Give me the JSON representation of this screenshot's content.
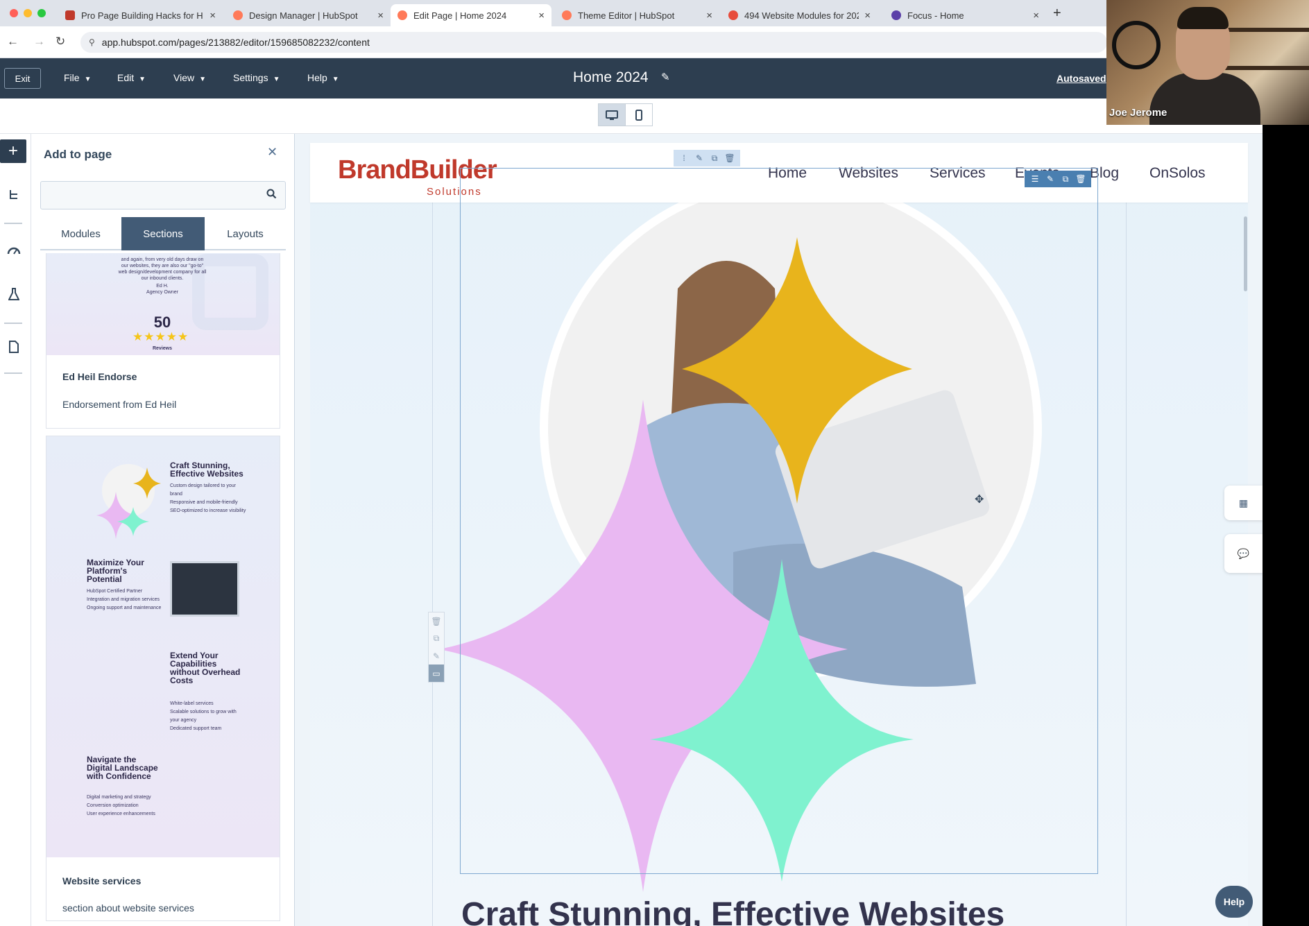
{
  "browser": {
    "tabs": [
      {
        "title": "Pro Page Building Hacks for H",
        "favicon_color": "#c0392b"
      },
      {
        "title": "Design Manager | HubSpot",
        "favicon_color": "#ff7a59"
      },
      {
        "title": "Edit Page | Home 2024",
        "favicon_color": "#ff7a59"
      },
      {
        "title": "Theme Editor | HubSpot",
        "favicon_color": "#ff7a59"
      },
      {
        "title": "494 Website Modules for 202",
        "favicon_color": "#e74c3c"
      },
      {
        "title": "Focus - Home",
        "favicon_color": "#5b3fa8"
      }
    ],
    "url": "app.hubspot.com/pages/213882/editor/159685082232/content"
  },
  "editor": {
    "exit_label": "Exit",
    "menus": [
      "File",
      "Edit",
      "View",
      "Settings",
      "Help"
    ],
    "page_title": "Home 2024",
    "autosaved_label": "Autosaved"
  },
  "panel": {
    "title": "Add to page",
    "search_placeholder": "",
    "tabs": [
      "Modules",
      "Sections",
      "Layouts"
    ],
    "active_tab": "Sections",
    "cards": [
      {
        "name": "Ed Heil Endorse",
        "description": "Endorsement from Ed Heil",
        "thumb": {
          "quote": "and again, from very old days draw on our websites, they are also our \"go-to\" web design/development company for all our inbound clients.",
          "author": "Ed H.",
          "author_role": "Agency Owner",
          "review_count": "50",
          "review_label": "Reviews",
          "stars": "★★★★★"
        }
      },
      {
        "name": "Website services",
        "description": "section about website services",
        "thumb": {
          "h1": "Craft Stunning, Effective Websites",
          "h2": "Maximize Your Platform's Potential",
          "h3": "Extend Your Capabilities without Overhead Costs",
          "h4": "Navigate the Digital Landscape with Confidence",
          "bullets1": [
            "Custom design tailored to your brand",
            "Responsive and mobile-friendly",
            "SEO-optimized to increase visibility"
          ],
          "bullets2": [
            "HubSpot Certified Partner",
            "Integration and migration services",
            "Ongoing support and maintenance"
          ],
          "bullets3": [
            "White-label services",
            "Scalable solutions to grow with your agency",
            "Dedicated support team"
          ],
          "bullets4": [
            "Digital marketing and strategy",
            "Conversion optimization",
            "User experience enhancements"
          ]
        }
      }
    ]
  },
  "site": {
    "logo_main": "BrandBuilder",
    "logo_sub": "Solutions",
    "nav": [
      "Home",
      "Websites",
      "Services",
      "Events",
      "Blog",
      "OnSolos"
    ],
    "headline": "Craft Stunning, Effective Websites"
  },
  "widgets": {
    "help_label": "Help"
  },
  "webcam": {
    "name": "Joe Jerome"
  },
  "colors": {
    "hubspot_nav": "#2d3e50",
    "active_tab": "#425b76",
    "logo_red": "#c0392b",
    "star_yellow": "#e8b41c",
    "star_pink": "#e9b8f2",
    "star_mint": "#7ff2cf"
  }
}
